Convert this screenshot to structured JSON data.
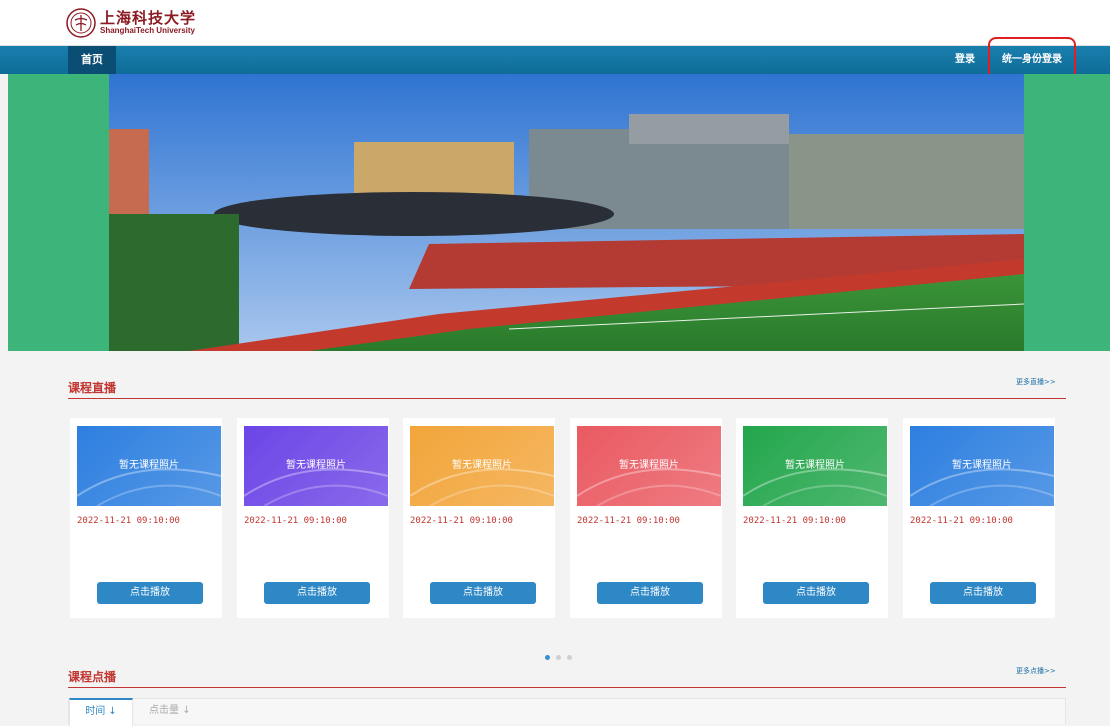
{
  "header": {
    "logo_cn": "上海科技大学",
    "logo_en": "ShanghaiTech University"
  },
  "nav": {
    "home": "首页",
    "login": "登录",
    "sso": "统一身份登录"
  },
  "live": {
    "title": "课程直播",
    "more": "更多直播>>"
  },
  "vod": {
    "title": "课程点播",
    "more": "更多点播>>"
  },
  "cards": [
    {
      "placeholder": "暂无课程照片",
      "date": "2022-11-21 09:10:00",
      "button": "点击播放",
      "color": "#2d7fe0"
    },
    {
      "placeholder": "暂无课程照片",
      "date": "2022-11-21 09:10:00",
      "button": "点击播放",
      "color": "#6c45e6"
    },
    {
      "placeholder": "暂无课程照片",
      "date": "2022-11-21 09:10:00",
      "button": "点击播放",
      "color": "#f2a53a"
    },
    {
      "placeholder": "暂无课程照片",
      "date": "2022-11-21 09:10:00",
      "button": "点击播放",
      "color": "#ea5a62"
    },
    {
      "placeholder": "暂无课程照片",
      "date": "2022-11-21 09:10:00",
      "button": "点击播放",
      "color": "#23a64c"
    },
    {
      "placeholder": "暂无课程照片",
      "date": "2022-11-21 09:10:00",
      "button": "点击播放",
      "color": "#2d7fe0"
    }
  ],
  "carousel": {
    "pages": 3,
    "active": 1
  },
  "tabs": {
    "time": "时间",
    "views": "点击量",
    "arrow": "↓"
  }
}
